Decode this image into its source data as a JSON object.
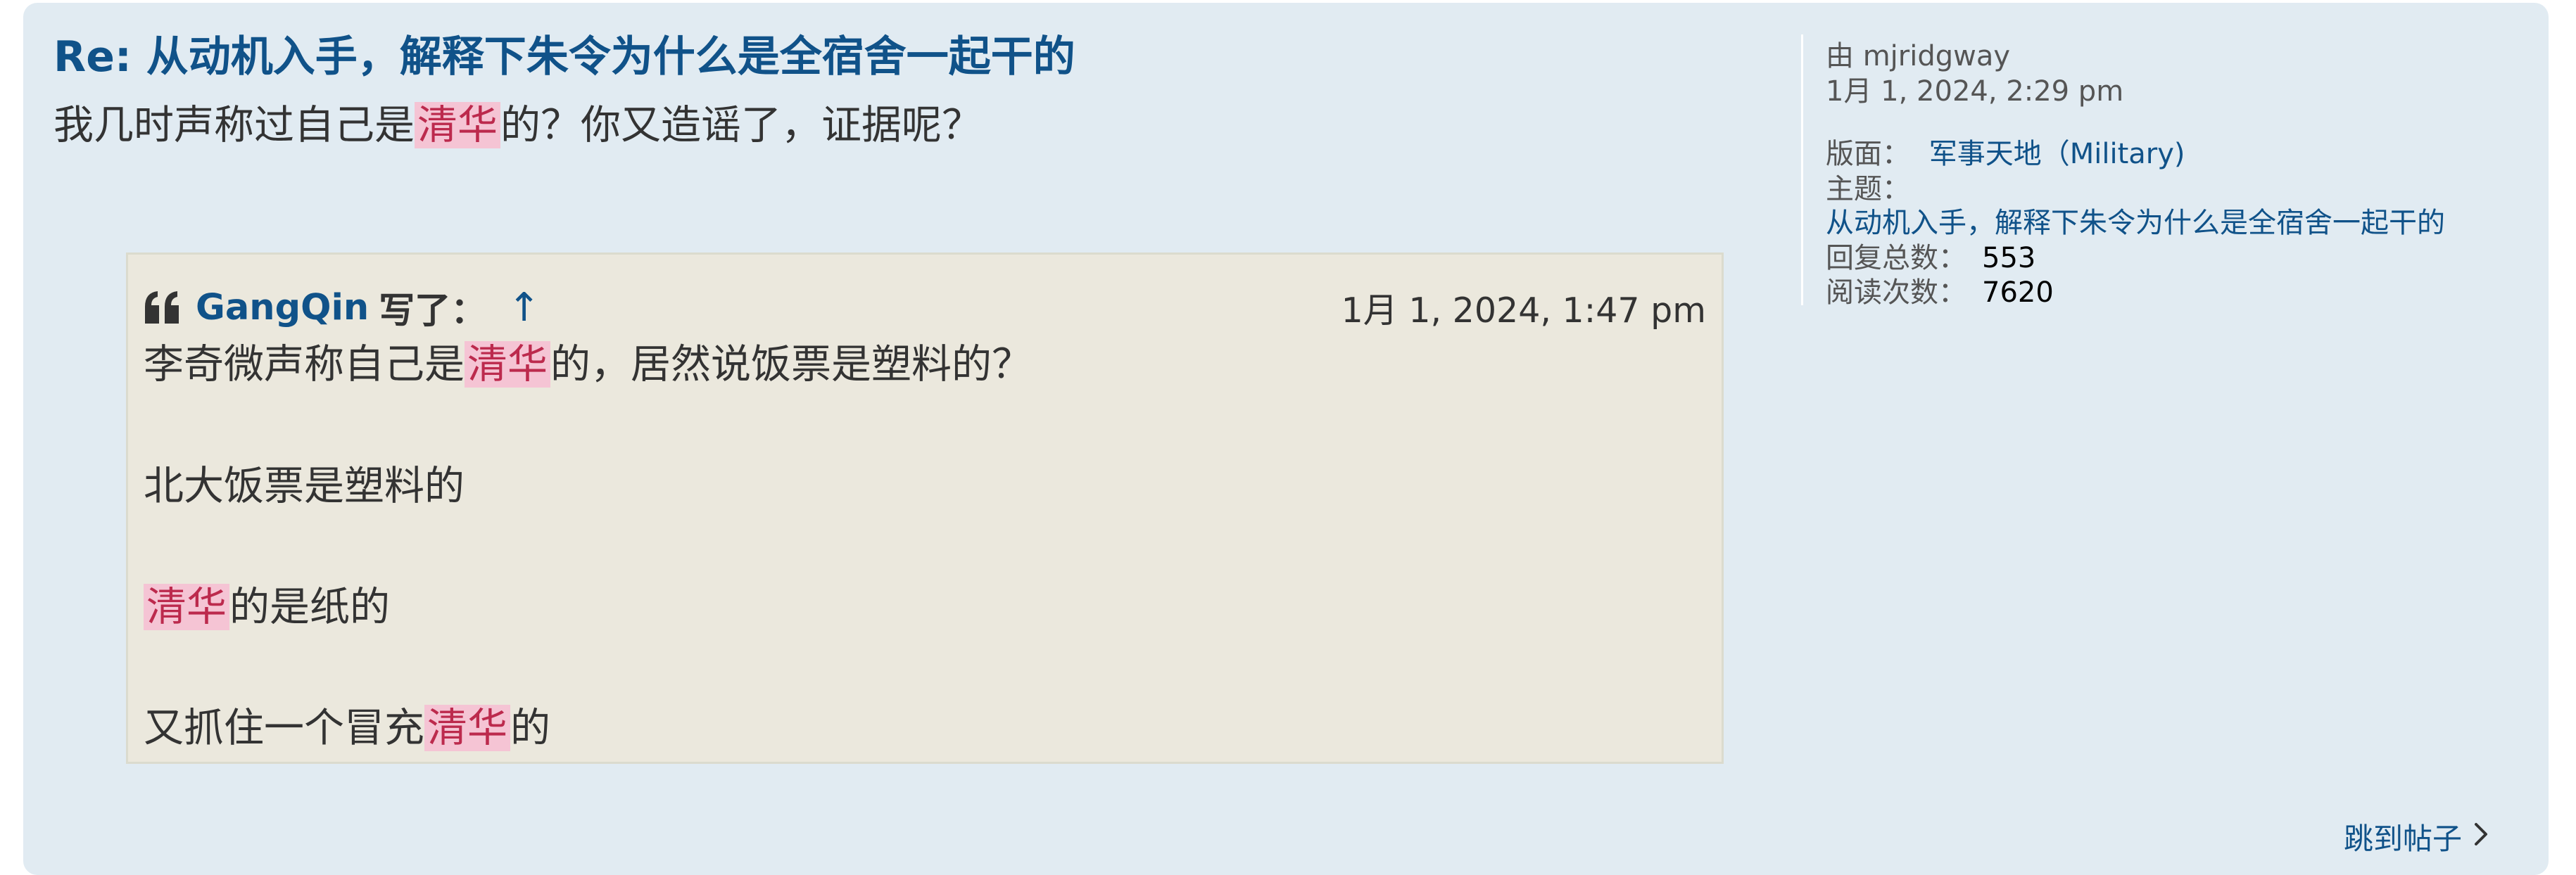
{
  "post": {
    "title": "Re: 从动机入手，解释下朱令为什么是全宿舍一起干的",
    "body": {
      "before": "我几时声称过自己是",
      "highlight": "清华",
      "after": "的？你又造谣了，证据呢？"
    },
    "quote": {
      "author": "GangQin",
      "wrote_label": "写了：",
      "up_arrow": "↑",
      "date": "1月 1, 2024, 1:47 pm",
      "line1": {
        "before": "李奇微声称自己是",
        "highlight": "清华",
        "after": "的，居然说饭票是塑料的？"
      },
      "line2": "北大饭票是塑料的",
      "line3": {
        "highlight": "清华",
        "after": "的是纸的"
      },
      "line4": {
        "before": "又抓住一个冒充",
        "highlight": "清华",
        "after": "的"
      }
    },
    "jump_link": "跳到帖子"
  },
  "meta": {
    "by": "由 mjridgway",
    "date": "1月 1, 2024, 2:29 pm",
    "forum_label": "版面：",
    "forum_value": "军事天地（Military)",
    "topic_label": "主题：",
    "topic_value": "从动机入手，解释下朱令为什么是全宿舍一起干的",
    "replies_label": "回复总数：",
    "replies_value": "553",
    "views_label": "阅读次数：",
    "views_value": "7620"
  },
  "icons": {
    "quote": "quote-icon",
    "chevron": "chevron-right-icon"
  },
  "colors": {
    "card_bg": "#e1ebf2",
    "quote_bg": "#ebe8dd",
    "link": "#105289",
    "highlight_bg": "#f5c4d4",
    "highlight_text": "#bc2a4d",
    "text": "#333333"
  }
}
